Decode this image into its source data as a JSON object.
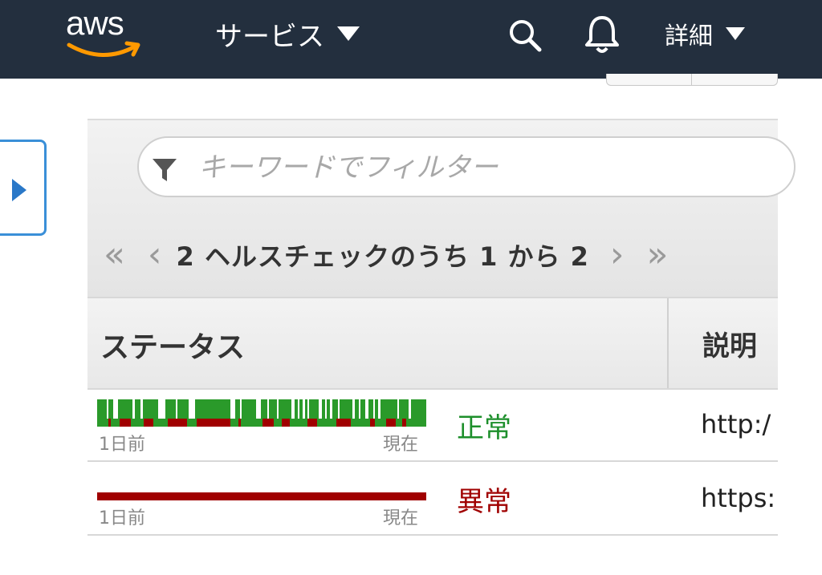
{
  "nav": {
    "logo_text": "aws",
    "services_label": "サービス",
    "detail_label": "詳細"
  },
  "filter": {
    "placeholder": "キーワードでフィルター"
  },
  "pager": {
    "first": "«",
    "prev": "‹",
    "text": "2 ヘルスチェックのうち 1 から 2",
    "next": "›",
    "last": "»"
  },
  "table": {
    "headers": {
      "status": "ステータス",
      "description": "説明"
    },
    "rows": [
      {
        "bar_start_label": "1日前",
        "bar_end_label": "現在",
        "status": "正常",
        "description": "http:/"
      },
      {
        "bar_start_label": "1日前",
        "bar_end_label": "現在",
        "status": "異常",
        "description": "https:"
      }
    ]
  },
  "colors": {
    "nav_bg": "#232f3e",
    "healthy": "#1d8f2b",
    "unhealthy": "#a00000",
    "accent_blue": "#3a8fd8"
  }
}
